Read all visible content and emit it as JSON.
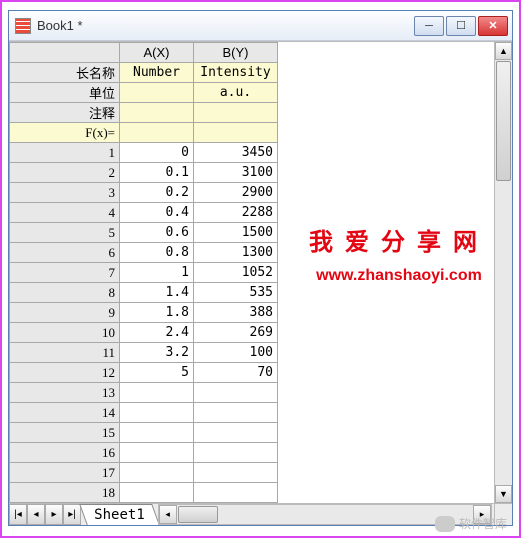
{
  "window": {
    "title": "Book1 *"
  },
  "columns": {
    "a": "A(X)",
    "b": "B(Y)"
  },
  "header_rows": {
    "longname": {
      "label": "长名称",
      "a": "Number",
      "b": "Intensity"
    },
    "units": {
      "label": "单位",
      "a": "",
      "b": "a.u."
    },
    "comments": {
      "label": "注释",
      "a": "",
      "b": ""
    },
    "fx": {
      "label": "F(x)=",
      "a": "",
      "b": ""
    }
  },
  "rows": [
    {
      "n": "1",
      "a": "0",
      "b": "3450"
    },
    {
      "n": "2",
      "a": "0.1",
      "b": "3100"
    },
    {
      "n": "3",
      "a": "0.2",
      "b": "2900"
    },
    {
      "n": "4",
      "a": "0.4",
      "b": "2288"
    },
    {
      "n": "5",
      "a": "0.6",
      "b": "1500"
    },
    {
      "n": "6",
      "a": "0.8",
      "b": "1300"
    },
    {
      "n": "7",
      "a": "1",
      "b": "1052"
    },
    {
      "n": "8",
      "a": "1.4",
      "b": "535"
    },
    {
      "n": "9",
      "a": "1.8",
      "b": "388"
    },
    {
      "n": "10",
      "a": "2.4",
      "b": "269"
    },
    {
      "n": "11",
      "a": "3.2",
      "b": "100"
    },
    {
      "n": "12",
      "a": "5",
      "b": "70"
    },
    {
      "n": "13",
      "a": "",
      "b": ""
    },
    {
      "n": "14",
      "a": "",
      "b": ""
    },
    {
      "n": "15",
      "a": "",
      "b": ""
    },
    {
      "n": "16",
      "a": "",
      "b": ""
    },
    {
      "n": "17",
      "a": "",
      "b": ""
    },
    {
      "n": "18",
      "a": "",
      "b": ""
    }
  ],
  "sheet_tab": "Sheet1",
  "watermark": {
    "line1": "我爱分享网",
    "line2": "www.zhanshaoyi.com"
  },
  "footer": "软件智库",
  "chart_data": {
    "type": "table",
    "columns": [
      "Number",
      "Intensity"
    ],
    "units": [
      "",
      "a.u."
    ],
    "data": [
      [
        0,
        3450
      ],
      [
        0.1,
        3100
      ],
      [
        0.2,
        2900
      ],
      [
        0.4,
        2288
      ],
      [
        0.6,
        1500
      ],
      [
        0.8,
        1300
      ],
      [
        1,
        1052
      ],
      [
        1.4,
        535
      ],
      [
        1.8,
        388
      ],
      [
        2.4,
        269
      ],
      [
        3.2,
        100
      ],
      [
        5,
        70
      ]
    ]
  }
}
